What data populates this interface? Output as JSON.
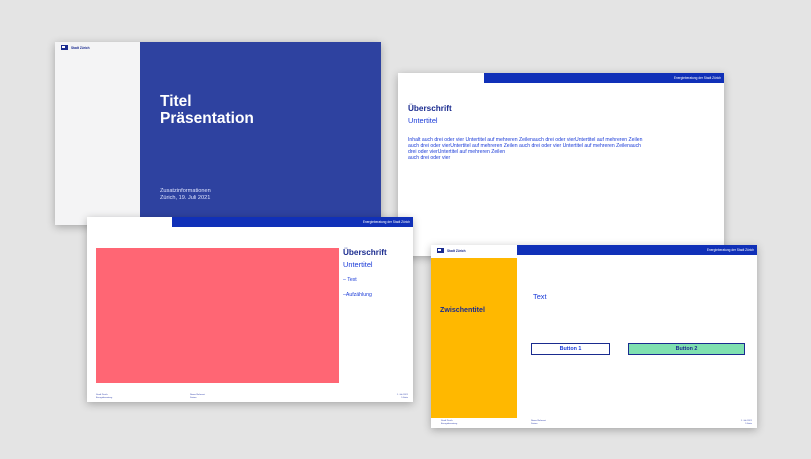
{
  "colors": {
    "background": "#e4e4e4",
    "title_panel": "#2e42a0",
    "header_bar": "#1030b8",
    "heading_text": "#1a2b8f",
    "body_text": "#1a3bd8",
    "image_placeholder": "#ff6674",
    "section_panel": "#ffb800",
    "button_2": "#7fe0b0"
  },
  "logo": {
    "text": "Stadt Zürich",
    "icon": "zurich-logo-icon"
  },
  "header_bar_text": "Energieberatung der Stadt Zürich",
  "slide_title": {
    "title_line1": "Titel",
    "title_line2": "Präsentation",
    "info_line1": "Zusatzinformationen",
    "info_line2": "Zürich, 19. Juli 2021"
  },
  "slide_text": {
    "heading": "Überschrift",
    "subtitle": "Untertitel",
    "body": "Inhalt auch drei oder vier Untertitel auf mehreren Zeilenauch drei oder vierUntertitel auf mehreren Zeilen\nauch drei oder vierUntertitel auf mehreren Zeilen auch drei oder vier Untertitel auf mehreren Zeilenauch drei oder vierUntertitel auf mehreren Zeilen\nauch drei oder vier"
  },
  "slide_image": {
    "heading": "Überschrift",
    "subtitle": "Untertitel",
    "list_item_1": "– Text",
    "list_item_2": "–Aufzählung",
    "footer_left": "Stadt Zürich\nEnergieberatung",
    "footer_mid": "Name Referent\nDatum",
    "footer_right": "1. Juli 2021\n5 Seite"
  },
  "slide_section": {
    "section_title": "Zwischentitel",
    "text": "Text",
    "button_1": "Button 1",
    "button_2": "Button 2",
    "footer_left": "Stadt Zürich\nEnergieberatung",
    "footer_mid": "Name Referent\nDatum",
    "footer_right": "1. Juli 2021\n5 Seite"
  }
}
